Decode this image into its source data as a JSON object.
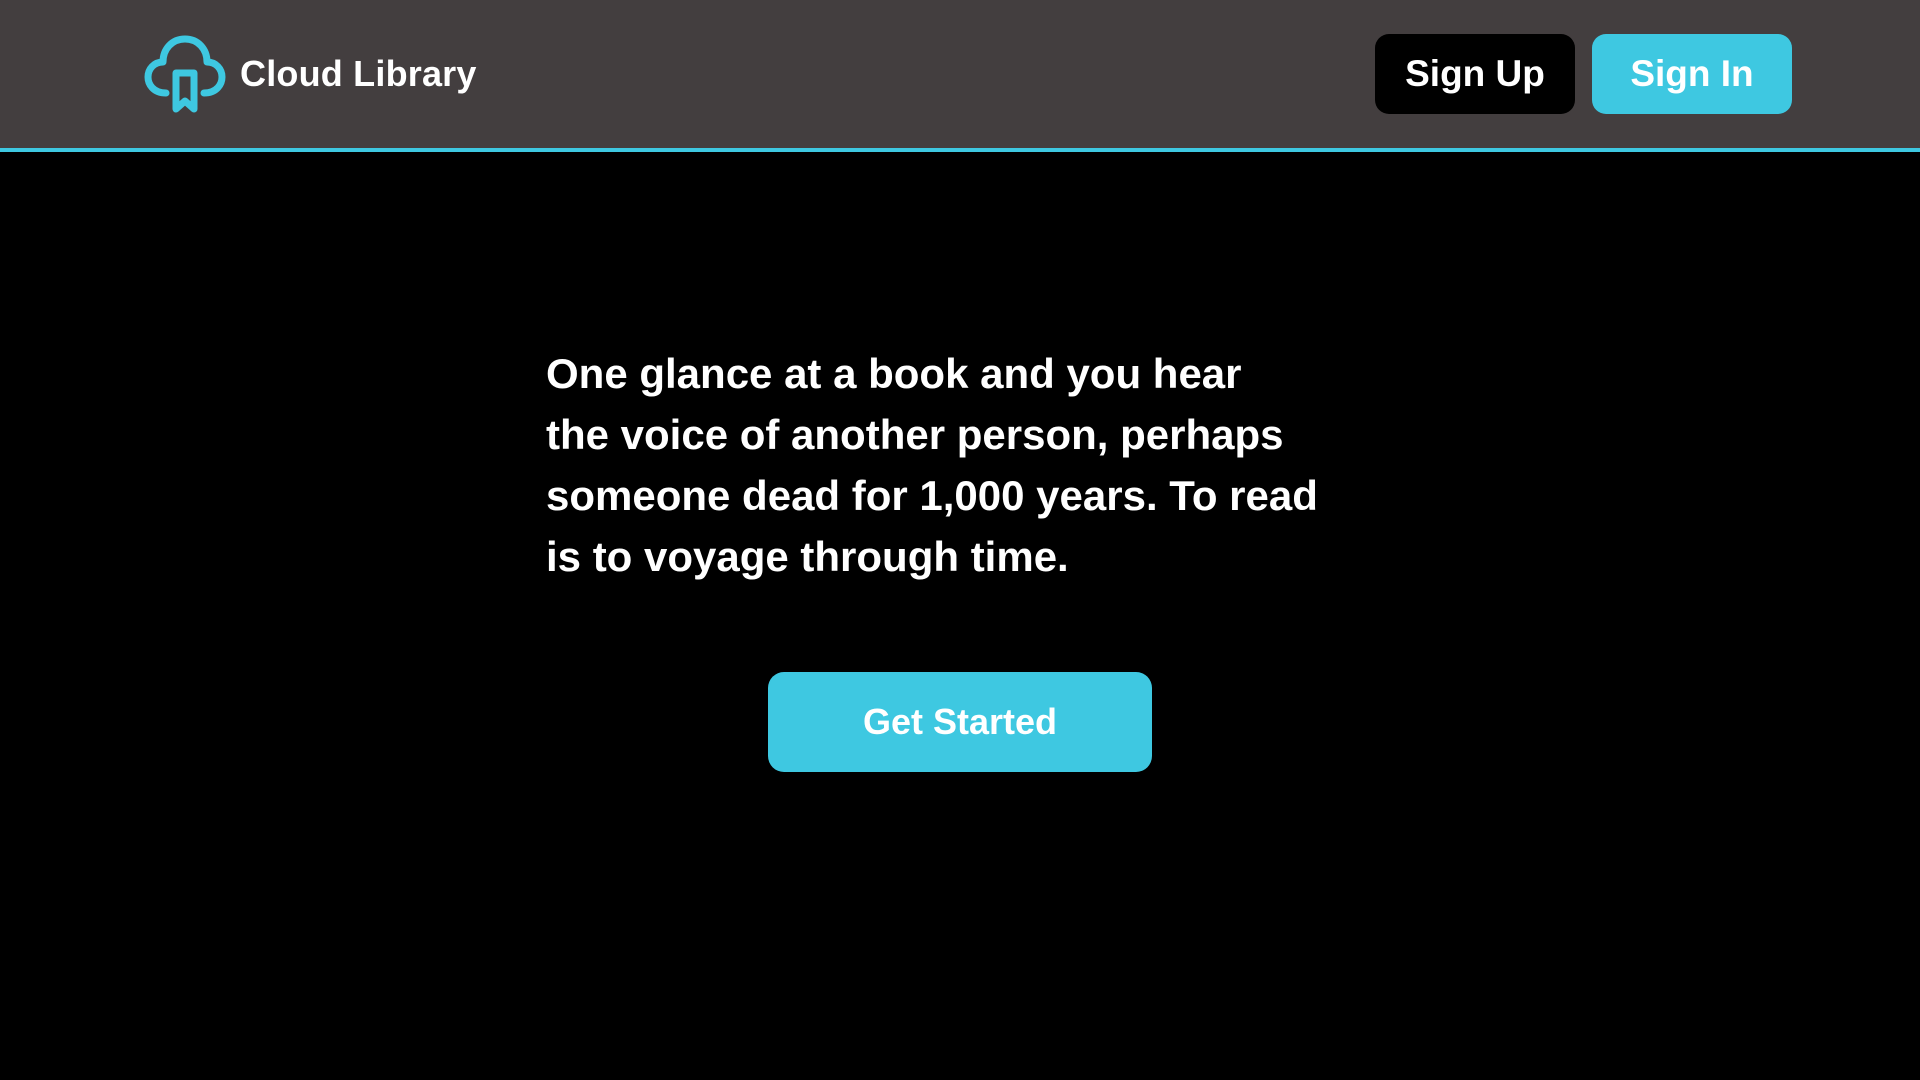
{
  "header": {
    "brand": {
      "name": "Cloud Library",
      "icon": "cloud-bookmark-icon"
    },
    "nav": {
      "sign_up_label": "Sign Up",
      "sign_in_label": "Sign In"
    }
  },
  "hero": {
    "quote": "One glance at a book and you hear\nthe voice of another person, perhaps\nsomeone dead for 1,000 years. To read\nis to voyage through time.",
    "cta_label": "Get Started"
  },
  "colors": {
    "accent": "#3ec8e1",
    "header_bg": "#433e3f",
    "page_bg": "#000000",
    "text": "#ffffff"
  }
}
